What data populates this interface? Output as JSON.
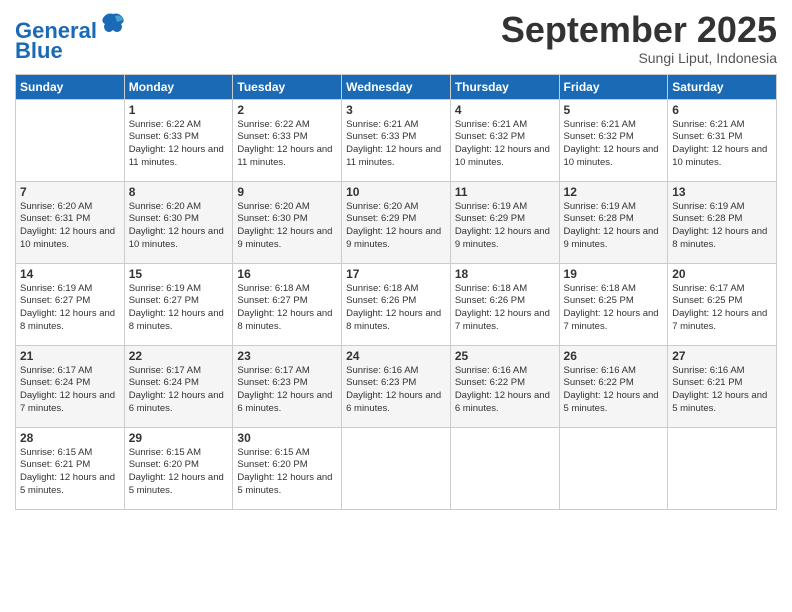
{
  "logo": {
    "line1": "General",
    "line2": "Blue"
  },
  "header": {
    "month": "September 2025",
    "location": "Sungi Liput, Indonesia"
  },
  "weekdays": [
    "Sunday",
    "Monday",
    "Tuesday",
    "Wednesday",
    "Thursday",
    "Friday",
    "Saturday"
  ],
  "weeks": [
    [
      {
        "day": null,
        "info": null
      },
      {
        "day": "1",
        "info": "Sunrise: 6:22 AM\nSunset: 6:33 PM\nDaylight: 12 hours\nand 11 minutes."
      },
      {
        "day": "2",
        "info": "Sunrise: 6:22 AM\nSunset: 6:33 PM\nDaylight: 12 hours\nand 11 minutes."
      },
      {
        "day": "3",
        "info": "Sunrise: 6:21 AM\nSunset: 6:33 PM\nDaylight: 12 hours\nand 11 minutes."
      },
      {
        "day": "4",
        "info": "Sunrise: 6:21 AM\nSunset: 6:32 PM\nDaylight: 12 hours\nand 10 minutes."
      },
      {
        "day": "5",
        "info": "Sunrise: 6:21 AM\nSunset: 6:32 PM\nDaylight: 12 hours\nand 10 minutes."
      },
      {
        "day": "6",
        "info": "Sunrise: 6:21 AM\nSunset: 6:31 PM\nDaylight: 12 hours\nand 10 minutes."
      }
    ],
    [
      {
        "day": "7",
        "info": "Sunrise: 6:20 AM\nSunset: 6:31 PM\nDaylight: 12 hours\nand 10 minutes."
      },
      {
        "day": "8",
        "info": "Sunrise: 6:20 AM\nSunset: 6:30 PM\nDaylight: 12 hours\nand 10 minutes."
      },
      {
        "day": "9",
        "info": "Sunrise: 6:20 AM\nSunset: 6:30 PM\nDaylight: 12 hours\nand 9 minutes."
      },
      {
        "day": "10",
        "info": "Sunrise: 6:20 AM\nSunset: 6:29 PM\nDaylight: 12 hours\nand 9 minutes."
      },
      {
        "day": "11",
        "info": "Sunrise: 6:19 AM\nSunset: 6:29 PM\nDaylight: 12 hours\nand 9 minutes."
      },
      {
        "day": "12",
        "info": "Sunrise: 6:19 AM\nSunset: 6:28 PM\nDaylight: 12 hours\nand 9 minutes."
      },
      {
        "day": "13",
        "info": "Sunrise: 6:19 AM\nSunset: 6:28 PM\nDaylight: 12 hours\nand 8 minutes."
      }
    ],
    [
      {
        "day": "14",
        "info": "Sunrise: 6:19 AM\nSunset: 6:27 PM\nDaylight: 12 hours\nand 8 minutes."
      },
      {
        "day": "15",
        "info": "Sunrise: 6:19 AM\nSunset: 6:27 PM\nDaylight: 12 hours\nand 8 minutes."
      },
      {
        "day": "16",
        "info": "Sunrise: 6:18 AM\nSunset: 6:27 PM\nDaylight: 12 hours\nand 8 minutes."
      },
      {
        "day": "17",
        "info": "Sunrise: 6:18 AM\nSunset: 6:26 PM\nDaylight: 12 hours\nand 8 minutes."
      },
      {
        "day": "18",
        "info": "Sunrise: 6:18 AM\nSunset: 6:26 PM\nDaylight: 12 hours\nand 7 minutes."
      },
      {
        "day": "19",
        "info": "Sunrise: 6:18 AM\nSunset: 6:25 PM\nDaylight: 12 hours\nand 7 minutes."
      },
      {
        "day": "20",
        "info": "Sunrise: 6:17 AM\nSunset: 6:25 PM\nDaylight: 12 hours\nand 7 minutes."
      }
    ],
    [
      {
        "day": "21",
        "info": "Sunrise: 6:17 AM\nSunset: 6:24 PM\nDaylight: 12 hours\nand 7 minutes."
      },
      {
        "day": "22",
        "info": "Sunrise: 6:17 AM\nSunset: 6:24 PM\nDaylight: 12 hours\nand 6 minutes."
      },
      {
        "day": "23",
        "info": "Sunrise: 6:17 AM\nSunset: 6:23 PM\nDaylight: 12 hours\nand 6 minutes."
      },
      {
        "day": "24",
        "info": "Sunrise: 6:16 AM\nSunset: 6:23 PM\nDaylight: 12 hours\nand 6 minutes."
      },
      {
        "day": "25",
        "info": "Sunrise: 6:16 AM\nSunset: 6:22 PM\nDaylight: 12 hours\nand 6 minutes."
      },
      {
        "day": "26",
        "info": "Sunrise: 6:16 AM\nSunset: 6:22 PM\nDaylight: 12 hours\nand 5 minutes."
      },
      {
        "day": "27",
        "info": "Sunrise: 6:16 AM\nSunset: 6:21 PM\nDaylight: 12 hours\nand 5 minutes."
      }
    ],
    [
      {
        "day": "28",
        "info": "Sunrise: 6:15 AM\nSunset: 6:21 PM\nDaylight: 12 hours\nand 5 minutes."
      },
      {
        "day": "29",
        "info": "Sunrise: 6:15 AM\nSunset: 6:20 PM\nDaylight: 12 hours\nand 5 minutes."
      },
      {
        "day": "30",
        "info": "Sunrise: 6:15 AM\nSunset: 6:20 PM\nDaylight: 12 hours\nand 5 minutes."
      },
      {
        "day": null,
        "info": null
      },
      {
        "day": null,
        "info": null
      },
      {
        "day": null,
        "info": null
      },
      {
        "day": null,
        "info": null
      }
    ]
  ]
}
